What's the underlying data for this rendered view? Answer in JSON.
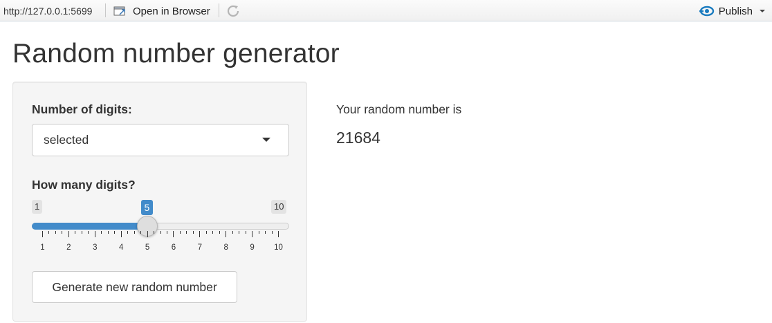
{
  "toolbar": {
    "url": "http://127.0.0.1:5699",
    "open_in_browser_label": "Open in Browser",
    "publish_label": "Publish",
    "icons": {
      "open_in_browser": "browser-window-icon",
      "refresh": "refresh-icon",
      "publish": "publish-icon",
      "publish_menu": "chevron-down-icon"
    },
    "accent_color": "#1a7bbf"
  },
  "page": {
    "title": "Random number generator"
  },
  "sidebar": {
    "digits_select": {
      "label": "Number of digits:",
      "selected_value": "selected"
    },
    "digits_slider": {
      "label": "How many digits?",
      "min": 1,
      "max": 10,
      "value": 5,
      "min_label": "1",
      "max_label": "10",
      "value_label": "5",
      "ticks": [
        "1",
        "2",
        "3",
        "4",
        "5",
        "6",
        "7",
        "8",
        "9",
        "10"
      ],
      "accent_color": "#428bca"
    },
    "generate_button_label": "Generate new random number"
  },
  "main": {
    "result_label": "Your random number is",
    "result_value": "21684"
  }
}
